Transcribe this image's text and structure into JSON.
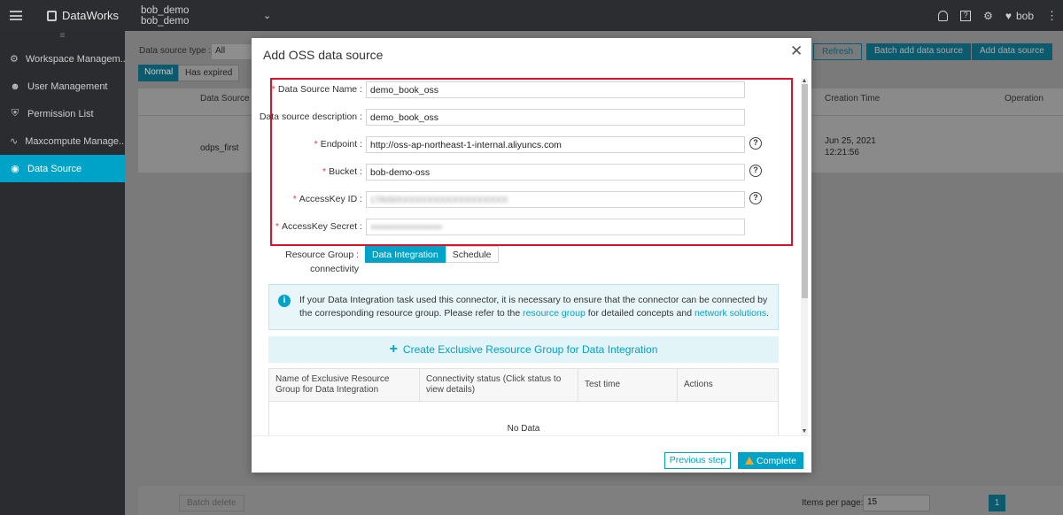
{
  "topbar": {
    "app_name": "DataWorks",
    "workspace_line1": "bob_demo",
    "workspace_line2": "bob_demo",
    "user": "bob"
  },
  "sidebar": {
    "collapse_glyph": "≡",
    "items": [
      {
        "label": "Workspace Managem...",
        "icon": "gear-icon"
      },
      {
        "label": "User Management",
        "icon": "users-icon"
      },
      {
        "label": "Permission List",
        "icon": "shield-icon"
      },
      {
        "label": "Maxcompute Manage...",
        "icon": "chart-icon"
      },
      {
        "label": "Data Source",
        "icon": "datasource-icon",
        "active": true
      }
    ]
  },
  "background": {
    "type_label": "Data source type :",
    "type_value": "All",
    "tab_normal": "Normal",
    "tab_expired": "Has expired",
    "btn_refresh": "Refresh",
    "btn_batch_add": "Batch add data source",
    "btn_add": "Add data source",
    "col_name": "Data Source N",
    "col_creation": "Creation Time",
    "col_operation": "Operation",
    "row_name": "odps_first",
    "row_date": "Jun 25, 2021",
    "row_time": "12:21:56",
    "batch_delete": "Batch delete",
    "items_per_page_label": "Items per page:",
    "items_per_page_value": "15",
    "current_page": "1"
  },
  "modal": {
    "title": "Add OSS data source",
    "fields": {
      "name_label": "Data Source Name :",
      "name_value": "demo_book_oss",
      "desc_label": "Data source description :",
      "desc_value": "demo_book_oss",
      "endpoint_label": "Endpoint :",
      "endpoint_value": "http://oss-ap-northeast-1-internal.aliyuncs.com",
      "bucket_label": "Bucket :",
      "bucket_value": "bob-demo-oss",
      "akid_label": "AccessKey ID :",
      "akid_value": "LTAI5tXXXXXXXXXXXXXXXXXX",
      "aksecret_label": "AccessKey Secret :",
      "aksecret_value": "••••••••••••••••••••••"
    },
    "resource_group": {
      "label_line1": "Resource Group :",
      "label_line2": "connectivity",
      "tab_integration": "Data Integration",
      "tab_schedule": "Schedule"
    },
    "info": {
      "part1": "If your Data Integration task used this connector, it is necessary to ensure that the connector can be connected by the corresponding resource group. Please refer to the ",
      "link1": "resource group",
      "part2": " for detailed concepts and ",
      "link2": "network solutions",
      "part3": "."
    },
    "create_label": "Create Exclusive Resource Group for Data Integration",
    "table": {
      "headers": [
        "Name of Exclusive Resource Group for Data Integration",
        "Connectivity status (Click status to view details)",
        "Test time",
        "Actions"
      ],
      "empty": "No Data"
    },
    "btn_previous": "Previous step",
    "btn_complete": "Complete"
  },
  "colors": {
    "accent": "#00a3c8",
    "highlight_box": "#e0102a",
    "required": "#e0393e"
  }
}
